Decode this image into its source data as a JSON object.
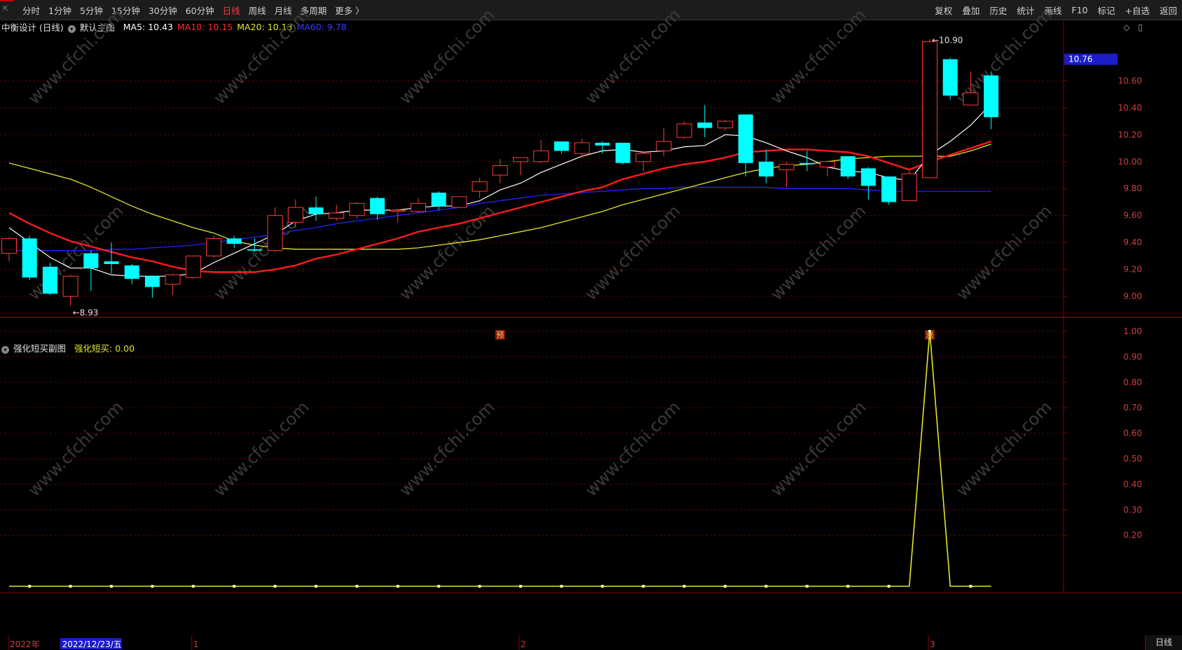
{
  "toolbar": {
    "left": [
      "分时",
      "1分钟",
      "5分钟",
      "15分钟",
      "30分钟",
      "60分钟",
      "日线",
      "周线",
      "月线",
      "多周期",
      "更多 〉"
    ],
    "active": "日线",
    "right": [
      "复权",
      "叠加",
      "历史",
      "统计",
      "画线",
      "F10",
      "标记",
      "+自选",
      "返回"
    ]
  },
  "main_legend": {
    "stock": "中衡设计 (日线)",
    "template": "默认主图",
    "ma5": "MA5: 10.43",
    "ma10": "MA10: 10.15",
    "ma20": "MA20: 10.13",
    "ma60": "MA60: 9.78"
  },
  "sub_legend": {
    "name": "强化短买副图",
    "value": "强化短买: 0.00"
  },
  "bottom_tab": "日线",
  "chart_data": {
    "type": "candlestick",
    "price_axis": {
      "ylim": [
        8.85,
        10.95
      ],
      "ticks": [
        9.0,
        9.2,
        9.4,
        9.6,
        9.8,
        10.0,
        10.2,
        10.4,
        10.6
      ],
      "tick_labels": [
        "9.00",
        "9.20",
        "9.40",
        "9.60",
        "9.80",
        "10.00",
        "10.20",
        "10.40",
        "10.60"
      ],
      "current_price_label": "10.76",
      "current_price": 10.76
    },
    "candles": [
      {
        "o": 9.32,
        "h": 9.44,
        "l": 9.26,
        "c": 9.43
      },
      {
        "o": 9.43,
        "h": 9.45,
        "l": 9.12,
        "c": 9.14
      },
      {
        "o": 9.22,
        "h": 9.25,
        "l": 9.01,
        "c": 9.02
      },
      {
        "o": 9.0,
        "h": 9.16,
        "l": 8.93,
        "c": 9.15
      },
      {
        "o": 9.32,
        "h": 9.34,
        "l": 9.04,
        "c": 9.21
      },
      {
        "o": 9.26,
        "h": 9.4,
        "l": 9.17,
        "c": 9.24
      },
      {
        "o": 9.23,
        "h": 9.24,
        "l": 9.09,
        "c": 9.13
      },
      {
        "o": 9.15,
        "h": 9.15,
        "l": 8.99,
        "c": 9.07
      },
      {
        "o": 9.09,
        "h": 9.17,
        "l": 9.01,
        "c": 9.16
      },
      {
        "o": 9.14,
        "h": 9.3,
        "l": 9.13,
        "c": 9.3
      },
      {
        "o": 9.3,
        "h": 9.45,
        "l": 9.29,
        "c": 9.43
      },
      {
        "o": 9.43,
        "h": 9.45,
        "l": 9.36,
        "c": 9.39
      },
      {
        "o": 9.35,
        "h": 9.43,
        "l": 9.33,
        "c": 9.34
      },
      {
        "o": 9.34,
        "h": 9.66,
        "l": 9.33,
        "c": 9.6
      },
      {
        "o": 9.55,
        "h": 9.72,
        "l": 9.51,
        "c": 9.66
      },
      {
        "o": 9.66,
        "h": 9.74,
        "l": 9.56,
        "c": 9.61
      },
      {
        "o": 9.58,
        "h": 9.68,
        "l": 9.56,
        "c": 9.62
      },
      {
        "o": 9.6,
        "h": 9.7,
        "l": 9.58,
        "c": 9.69
      },
      {
        "o": 9.73,
        "h": 9.74,
        "l": 9.57,
        "c": 9.61
      },
      {
        "o": 9.64,
        "h": 9.65,
        "l": 9.55,
        "c": 9.64
      },
      {
        "o": 9.63,
        "h": 9.73,
        "l": 9.62,
        "c": 9.69
      },
      {
        "o": 9.77,
        "h": 9.78,
        "l": 9.64,
        "c": 9.67
      },
      {
        "o": 9.66,
        "h": 9.74,
        "l": 9.66,
        "c": 9.74
      },
      {
        "o": 9.78,
        "h": 9.88,
        "l": 9.73,
        "c": 9.85
      },
      {
        "o": 9.9,
        "h": 10.02,
        "l": 9.84,
        "c": 9.97
      },
      {
        "o": 10.0,
        "h": 10.03,
        "l": 9.9,
        "c": 10.03
      },
      {
        "o": 10.0,
        "h": 10.16,
        "l": 9.99,
        "c": 10.08
      },
      {
        "o": 10.15,
        "h": 10.15,
        "l": 10.06,
        "c": 10.08
      },
      {
        "o": 10.06,
        "h": 10.17,
        "l": 10.03,
        "c": 10.14
      },
      {
        "o": 10.14,
        "h": 10.15,
        "l": 10.06,
        "c": 10.12
      },
      {
        "o": 10.14,
        "h": 10.14,
        "l": 9.98,
        "c": 9.99
      },
      {
        "o": 10.0,
        "h": 10.08,
        "l": 9.93,
        "c": 10.06
      },
      {
        "o": 10.08,
        "h": 10.25,
        "l": 10.04,
        "c": 10.15
      },
      {
        "o": 10.18,
        "h": 10.3,
        "l": 10.17,
        "c": 10.28
      },
      {
        "o": 10.29,
        "h": 10.42,
        "l": 10.18,
        "c": 10.25
      },
      {
        "o": 10.25,
        "h": 10.31,
        "l": 10.23,
        "c": 10.3
      },
      {
        "o": 10.35,
        "h": 10.35,
        "l": 9.89,
        "c": 9.99
      },
      {
        "o": 10.0,
        "h": 10.09,
        "l": 9.84,
        "c": 9.89
      },
      {
        "o": 9.94,
        "h": 10.0,
        "l": 9.81,
        "c": 9.98
      },
      {
        "o": 9.99,
        "h": 10.08,
        "l": 9.93,
        "c": 9.98
      },
      {
        "o": 9.96,
        "h": 10.01,
        "l": 9.89,
        "c": 10.0
      },
      {
        "o": 10.04,
        "h": 10.04,
        "l": 9.87,
        "c": 9.89
      },
      {
        "o": 9.95,
        "h": 9.96,
        "l": 9.72,
        "c": 9.82
      },
      {
        "o": 9.89,
        "h": 9.89,
        "l": 9.68,
        "c": 9.7
      },
      {
        "o": 9.71,
        "h": 9.93,
        "l": 9.71,
        "c": 9.91
      },
      {
        "o": 9.88,
        "h": 10.91,
        "l": 9.88,
        "c": 10.89
      },
      {
        "o": 10.76,
        "h": 10.77,
        "l": 10.46,
        "c": 10.49
      },
      {
        "o": 10.42,
        "h": 10.67,
        "l": 10.42,
        "c": 10.51
      },
      {
        "o": 10.64,
        "h": 10.67,
        "l": 10.24,
        "c": 10.33
      }
    ],
    "ma5": [
      9.51,
      9.4,
      9.29,
      9.21,
      9.21,
      9.16,
      9.15,
      9.15,
      9.15,
      9.17,
      9.25,
      9.32,
      9.39,
      9.46,
      9.56,
      9.61,
      9.62,
      9.64,
      9.64,
      9.64,
      9.66,
      9.67,
      9.67,
      9.71,
      9.79,
      9.84,
      9.92,
      9.98,
      10.04,
      10.08,
      10.09,
      10.07,
      10.08,
      10.11,
      10.12,
      10.2,
      10.19,
      10.14,
      10.08,
      10.03,
      9.96,
      9.93,
      9.92,
      9.88,
      9.86,
      10.05,
      10.15,
      10.27,
      10.43
    ],
    "ma10": [
      9.62,
      9.54,
      9.47,
      9.41,
      9.37,
      9.33,
      9.29,
      9.26,
      9.22,
      9.19,
      9.18,
      9.18,
      9.18,
      9.2,
      9.23,
      9.28,
      9.31,
      9.35,
      9.39,
      9.43,
      9.48,
      9.51,
      9.54,
      9.58,
      9.62,
      9.66,
      9.7,
      9.74,
      9.78,
      9.81,
      9.87,
      9.91,
      9.95,
      9.98,
      10.0,
      10.03,
      10.07,
      10.08,
      10.09,
      10.09,
      10.08,
      10.07,
      10.04,
      9.99,
      9.94,
      10.0,
      10.05,
      10.1,
      10.15
    ],
    "ma20": [
      9.99,
      9.95,
      9.91,
      9.87,
      9.81,
      9.74,
      9.67,
      9.61,
      9.56,
      9.51,
      9.47,
      9.41,
      9.38,
      9.36,
      9.35,
      9.35,
      9.35,
      9.35,
      9.35,
      9.35,
      9.36,
      9.38,
      9.4,
      9.42,
      9.45,
      9.48,
      9.51,
      9.55,
      9.59,
      9.63,
      9.68,
      9.72,
      9.76,
      9.8,
      9.84,
      9.88,
      9.92,
      9.95,
      9.97,
      9.98,
      10.0,
      10.02,
      10.03,
      10.04,
      10.04,
      10.04,
      10.04,
      10.08,
      10.13
    ],
    "ma60": [
      9.34,
      9.34,
      9.34,
      9.34,
      9.34,
      9.35,
      9.35,
      9.36,
      9.37,
      9.38,
      9.4,
      9.42,
      9.44,
      9.46,
      9.49,
      9.51,
      9.54,
      9.56,
      9.58,
      9.6,
      9.62,
      9.64,
      9.66,
      9.69,
      9.71,
      9.73,
      9.75,
      9.76,
      9.77,
      9.78,
      9.79,
      9.8,
      9.8,
      9.81,
      9.81,
      9.81,
      9.81,
      9.81,
      9.8,
      9.8,
      9.8,
      9.8,
      9.79,
      9.78,
      9.78,
      9.78,
      9.78,
      9.78,
      9.78
    ],
    "annotations": [
      {
        "text": "←8.93",
        "index": 3,
        "price": 8.93
      },
      {
        "text": "←10.90",
        "index": 45,
        "price": 10.9
      }
    ],
    "markers": [
      {
        "text": "预",
        "index": 24
      },
      {
        "text": "涨",
        "index": 45
      }
    ],
    "indicator": {
      "name": "强化短买",
      "ylim": [
        0.0,
        1.0
      ],
      "ticks": [
        0.2,
        0.3,
        0.4,
        0.5,
        0.6,
        0.7,
        0.8,
        0.9,
        1.0
      ],
      "tick_labels": [
        "0.20",
        "0.30",
        "0.40",
        "0.50",
        "0.60",
        "0.70",
        "0.80",
        "0.90",
        "1.00"
      ],
      "values": [
        0,
        0,
        0,
        0,
        0,
        0,
        0,
        0,
        0,
        0,
        0,
        0,
        0,
        0,
        0,
        0,
        0,
        0,
        0,
        0,
        0,
        0,
        0,
        0,
        0,
        0,
        0,
        0,
        0,
        0,
        0,
        0,
        0,
        0,
        0,
        0,
        0,
        0,
        0,
        0,
        0,
        0,
        0,
        0,
        0,
        1,
        0,
        0,
        0
      ]
    },
    "time_axis": {
      "labels": [
        {
          "text": "2022年",
          "index": 0
        },
        {
          "text": "2022/12/23/五",
          "index": 3
        },
        {
          "text": "1",
          "index": 9
        },
        {
          "text": "2",
          "index": 25
        },
        {
          "text": "3",
          "index": 45
        }
      ]
    },
    "colors": {
      "up": "#ff3b3b",
      "down": "#00ffff",
      "ma5": "#ffffff",
      "ma10": "#ff1a1a",
      "ma20": "#e5e52a",
      "ma60": "#2222ff",
      "indicator": "#e5e52a",
      "grid": "#7a0000"
    },
    "watermark": "www.cfchi.com"
  }
}
